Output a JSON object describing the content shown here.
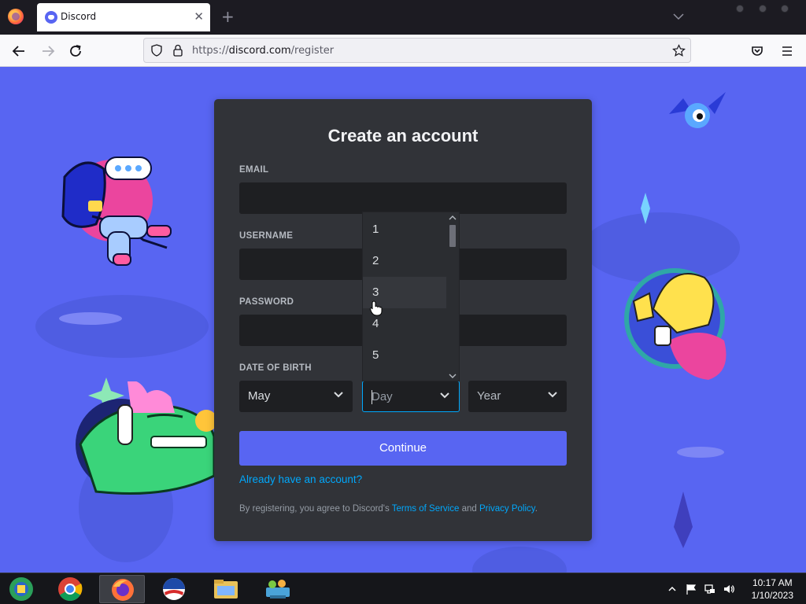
{
  "browser": {
    "tab_title": "Discord",
    "tab_close": "✕",
    "new_tab": "+",
    "url_prefix": "https://",
    "url_domain": "discord.com",
    "url_path": "/register"
  },
  "form": {
    "title": "Create an account",
    "email_label": "EMAIL",
    "username_label": "USERNAME",
    "password_label": "PASSWORD",
    "dob_label": "DATE OF BIRTH",
    "month_value": "May",
    "day_placeholder": "Day",
    "year_placeholder": "Year",
    "continue_label": "Continue",
    "login_link": "Already have an account?",
    "legal_prefix": "By registering, you agree to Discord's ",
    "terms_link": "Terms of Service",
    "legal_and": " and ",
    "privacy_link": "Privacy Policy",
    "legal_suffix": "."
  },
  "day_dropdown": {
    "options": [
      "1",
      "2",
      "3",
      "4",
      "5"
    ],
    "hovered": "3"
  },
  "taskbar": {
    "time": "10:17 AM",
    "date": "1/10/2023"
  },
  "colors": {
    "brand": "#5865f2",
    "card": "#313338",
    "input": "#1e1f22",
    "link": "#00a8fc"
  }
}
